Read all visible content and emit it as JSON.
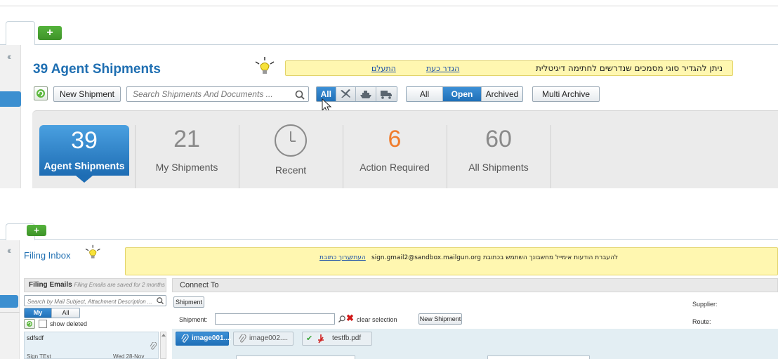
{
  "panel1": {
    "title": "39 Agent Shipments",
    "notice": {
      "text": "ניתן להגדיר סוגי מסמכים שנדרשים לחתימה דיגיטלית",
      "link_define": "הגדר כעת",
      "link_ignore": "התעלם"
    },
    "toolbar": {
      "new_shipment": "New Shipment",
      "search_placeholder": "Search Shipments And Documents ...",
      "mode_all": "All",
      "filter": [
        "All",
        "Open",
        "Archived"
      ],
      "filter_selected": "Open",
      "multi_archive": "Multi Archive"
    },
    "stats": [
      {
        "value": "39",
        "label": "Agent Shipments",
        "active": true
      },
      {
        "value": "21",
        "label": "My Shipments"
      },
      {
        "value": "",
        "label": "Recent"
      },
      {
        "value": "6",
        "label": "Action Required",
        "color": "#f07c2c"
      },
      {
        "value": "60",
        "label": "All Shipments"
      }
    ]
  },
  "panel2": {
    "title": "Filing Inbox",
    "notice": {
      "text": "להעברת הודעות אימייל מחשבונך השתמש בכתובת sign.gmail2@sandbox.mailgun.org",
      "link_copy": "העתק",
      "link_edit": "ערוך כתובת"
    },
    "sidebar": {
      "header_bold": "Filing Emails",
      "header_note": "Filing Emails are saved for 2 months only",
      "search_placeholder": "Search by Mail Subject, Attachment Description ...",
      "toggle": [
        "My",
        "All"
      ],
      "show_deleted": "show deleted",
      "item": {
        "subject": "sdfsdf",
        "from": "Sign TEst",
        "date": "Wed 28-Nov"
      }
    },
    "main": {
      "header": "Connect To",
      "shipment_tab": "Shipment",
      "shipment_label": "Shipment:",
      "clear_selection": "clear selection",
      "new_shipment": "New Shipment",
      "supplier_label": "Supplier:",
      "route_label": "Route:",
      "attachments": [
        "image001....",
        "image002....",
        "testfb.pdf"
      ]
    }
  },
  "colors": {
    "accent": "#1f6fb2",
    "notice_bg": "#fff7b0",
    "action_required": "#f07c2c",
    "add_green": "#4aa334"
  }
}
